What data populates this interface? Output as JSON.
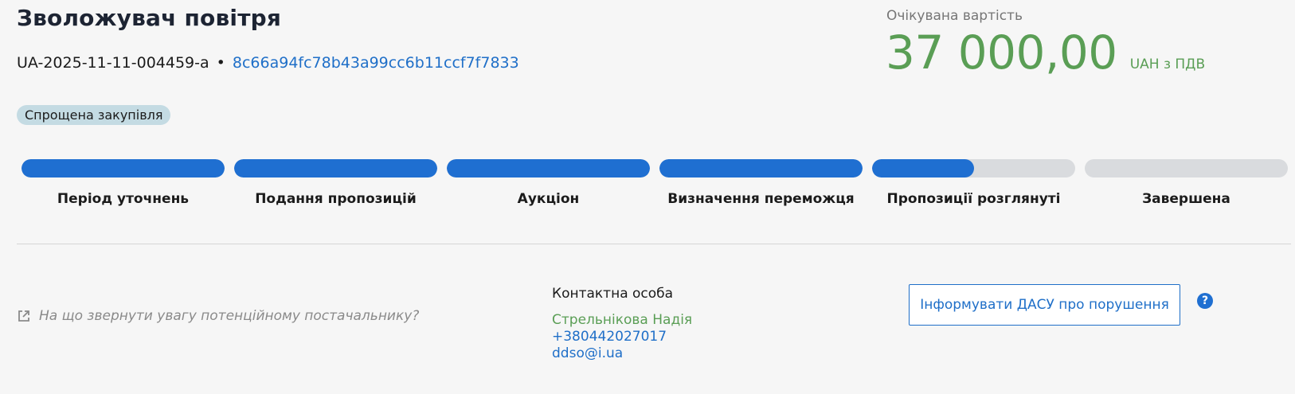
{
  "tender": {
    "title": "Зволожувач повітря",
    "tender_id": "UA-2025-11-11-004459-a",
    "separator": "•",
    "hash": "8c66a94fc78b43a99cc6b11ccf7f7833",
    "procedure_badge": "Спрощена закупівля"
  },
  "expected_value": {
    "label": "Очікувана вартість",
    "amount": "37 000,00",
    "currency": "UAH з ПДВ",
    "color": "#5a9e55"
  },
  "stages": [
    {
      "label": "Період уточнень",
      "progress": 1.0
    },
    {
      "label": "Подання пропозицій",
      "progress": 1.0
    },
    {
      "label": "Аукціон",
      "progress": 1.0
    },
    {
      "label": "Визначення переможця",
      "progress": 1.0
    },
    {
      "label": "Пропозиції розглянуті",
      "progress": 0.5
    },
    {
      "label": "Завершена",
      "progress": 0.0
    }
  ],
  "supplier_tip": {
    "icon": "external-link-icon",
    "text": "На що звернути увагу потенційному постачальнику?"
  },
  "contact": {
    "heading": "Контактна особа",
    "name": "Стрельнікова Надія",
    "phone": "+380442027017",
    "email": "ddso@i.ua"
  },
  "report_button": {
    "label": "Інформувати ДАСУ про порушення"
  },
  "help": {
    "icon": "question-icon",
    "glyph": "?"
  },
  "colors": {
    "accent_blue": "#1f6fd1",
    "link_blue": "#1f6fc8",
    "green": "#5a9e55",
    "badge_bg": "#c4dbe3"
  }
}
